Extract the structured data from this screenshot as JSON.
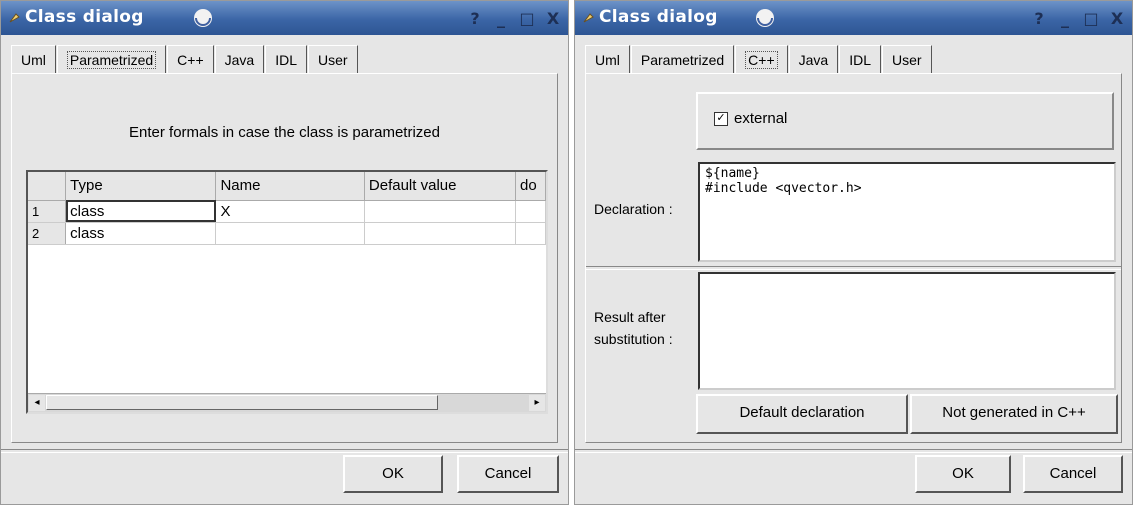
{
  "windows": [
    {
      "title": "Class dialog",
      "title_buttons": [
        "?",
        "_",
        "□",
        "X"
      ],
      "tabs": [
        "Uml",
        "Parametrized",
        "C++",
        "Java",
        "IDL",
        "User"
      ],
      "active_tab": "Parametrized",
      "hint": "Enter formals in case the class is parametrized",
      "table": {
        "columns": [
          "Type",
          "Name",
          "Default value",
          "do"
        ],
        "rows": [
          {
            "num": "1",
            "type": "class",
            "name": "X",
            "default": "",
            "do": ""
          },
          {
            "num": "2",
            "type": "class",
            "name": "",
            "default": "",
            "do": ""
          }
        ]
      },
      "scroll_left": "◂",
      "scroll_right": "▸",
      "ok_label": "OK",
      "cancel_label": "Cancel"
    },
    {
      "title": "Class dialog",
      "title_buttons": [
        "?",
        "_",
        "□",
        "X"
      ],
      "tabs": [
        "Uml",
        "Parametrized",
        "C++",
        "Java",
        "IDL",
        "User"
      ],
      "active_tab": "C++",
      "external_label": "external",
      "external_checked": true,
      "declaration_label": "Declaration :",
      "declaration_value": "${name}\n#include <qvector.h>",
      "result_label_line1": "Result after",
      "result_label_line2": "substitution :",
      "result_value": "",
      "default_decl_label": "Default declaration",
      "not_generated_label": "Not generated in C++",
      "ok_label": "OK",
      "cancel_label": "Cancel"
    }
  ],
  "colors": {
    "titlebar": "#3b65a6",
    "window_bg": "#e6e6e6"
  }
}
